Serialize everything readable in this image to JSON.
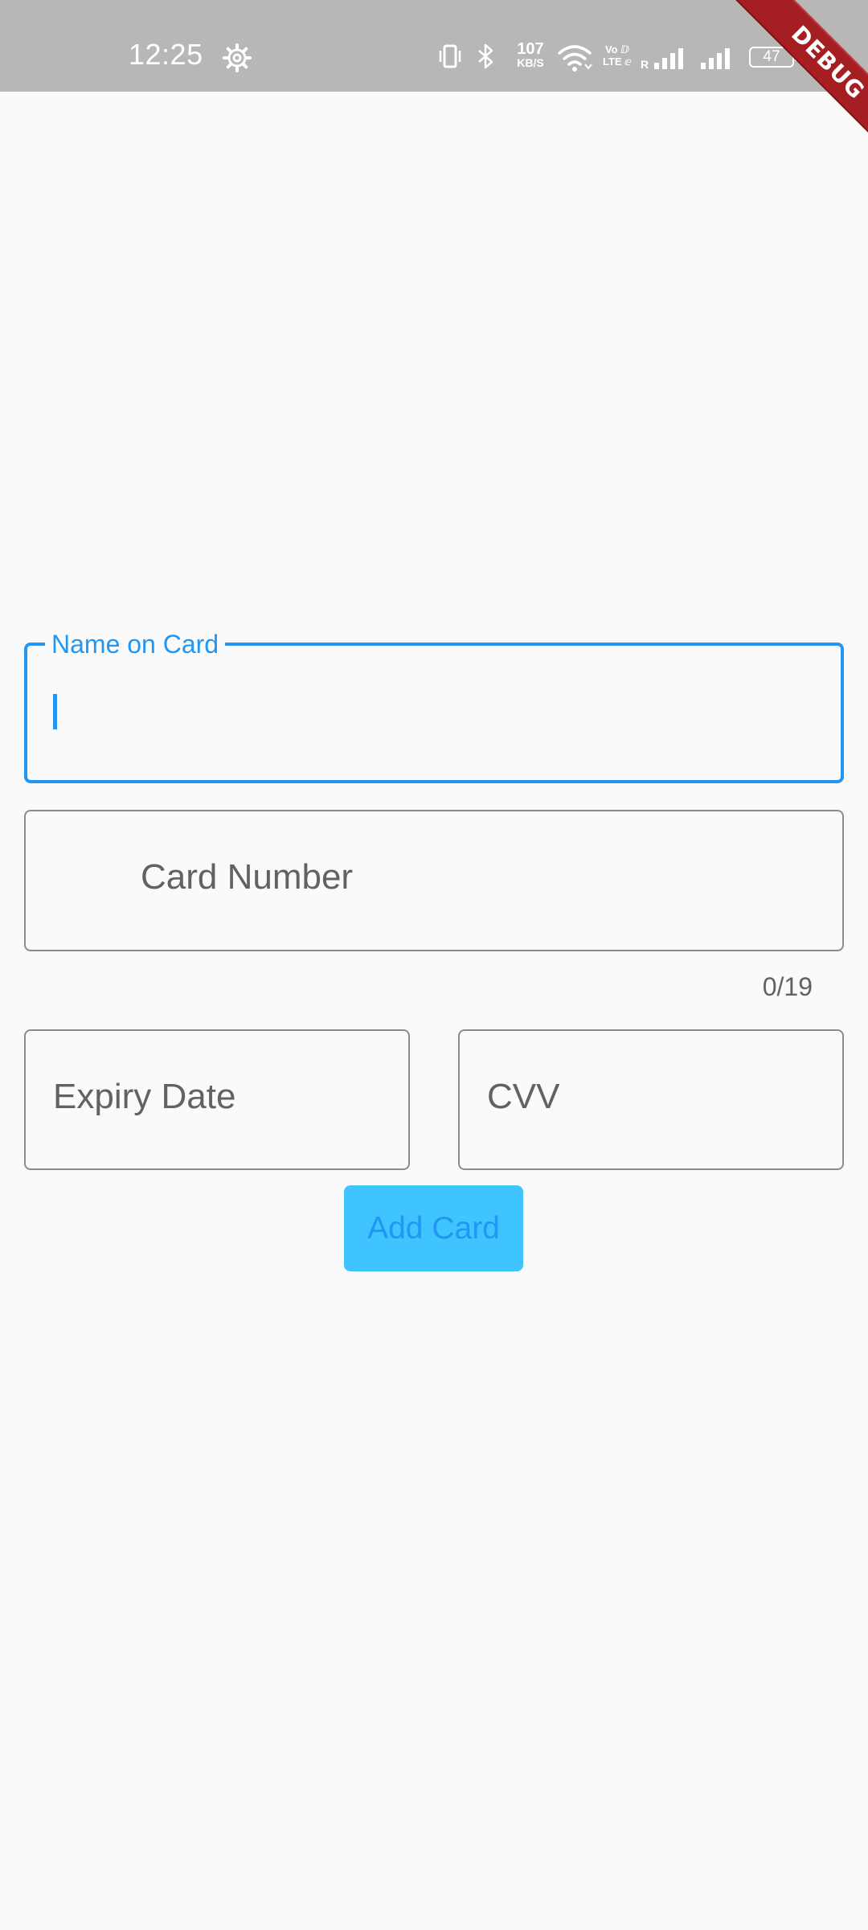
{
  "status_bar": {
    "time": "12:25",
    "net_speed_value": "107",
    "net_speed_unit": "KB/S",
    "volte_line1": "Vo ⅅ",
    "volte_line2": "LTE ⅇ",
    "roaming": "R",
    "battery": "47"
  },
  "debug_banner": "DEBUG",
  "form": {
    "name_field": {
      "label": "Name on Card",
      "value": ""
    },
    "card_number_field": {
      "placeholder": "Card Number",
      "counter": "0/19"
    },
    "expiry_field": {
      "placeholder": "Expiry Date"
    },
    "cvv_field": {
      "placeholder": "CVV"
    },
    "submit_label": "Add Card"
  },
  "colors": {
    "status_bar": "#b7b7b7",
    "focus_accent": "#2196f3",
    "button_bg": "#40c4ff",
    "ribbon": "#a51e22"
  }
}
